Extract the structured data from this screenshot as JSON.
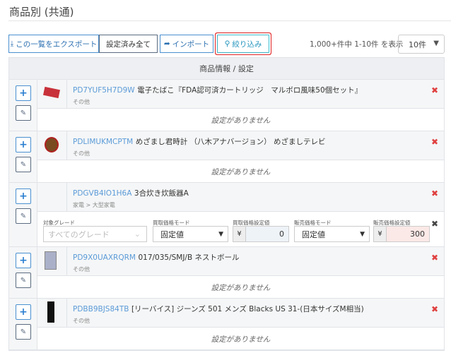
{
  "page_title": "商品別 (共通)",
  "toolbar": {
    "export": "この一覧をエクスポート",
    "all_set": "設定済み全て",
    "import": "インポート",
    "filter": "絞り込み"
  },
  "count_text": "1,000+件中 1-10件 を表示",
  "page_size": "10件",
  "table_header": "商品情報 / 設定",
  "empty_text": "設定がありません",
  "products": [
    {
      "code": "PD7YUF5H7D9W",
      "name": "電子たばこ『FDA認可済カートリッジ　マルボロ風味50個セット』",
      "category": "その他"
    },
    {
      "code": "PDLIMUKMCPTM",
      "name": "めざまし君時計 （八木アナバージョン） めざましテレビ",
      "category": "その他"
    },
    {
      "code": "PDGVB4IO1H6A",
      "name": "3合炊き炊飯器A",
      "category": "家電 > 大型家電"
    },
    {
      "code": "PD9X0UAXRQRM",
      "name": "017/035/SMJ/B ネストボール",
      "category": "その他"
    },
    {
      "code": "PDBB9BJS84TB",
      "name": "[リーバイス] ジーンズ 501 メンズ Blacks US 31-(日本サイズM相当)",
      "category": "その他"
    }
  ],
  "settings": {
    "grade_label": "対象グレード",
    "grade_placeholder": "すべてのグレード",
    "buy_mode_label": "買取価格モード",
    "buy_mode": "固定値",
    "buy_value_label": "買取価格設定値",
    "buy_value": "0",
    "sell_mode_label": "販売価格モード",
    "sell_mode": "固定値",
    "sell_value_label": "販売価格設定値",
    "sell_value": "300",
    "currency": "¥"
  }
}
